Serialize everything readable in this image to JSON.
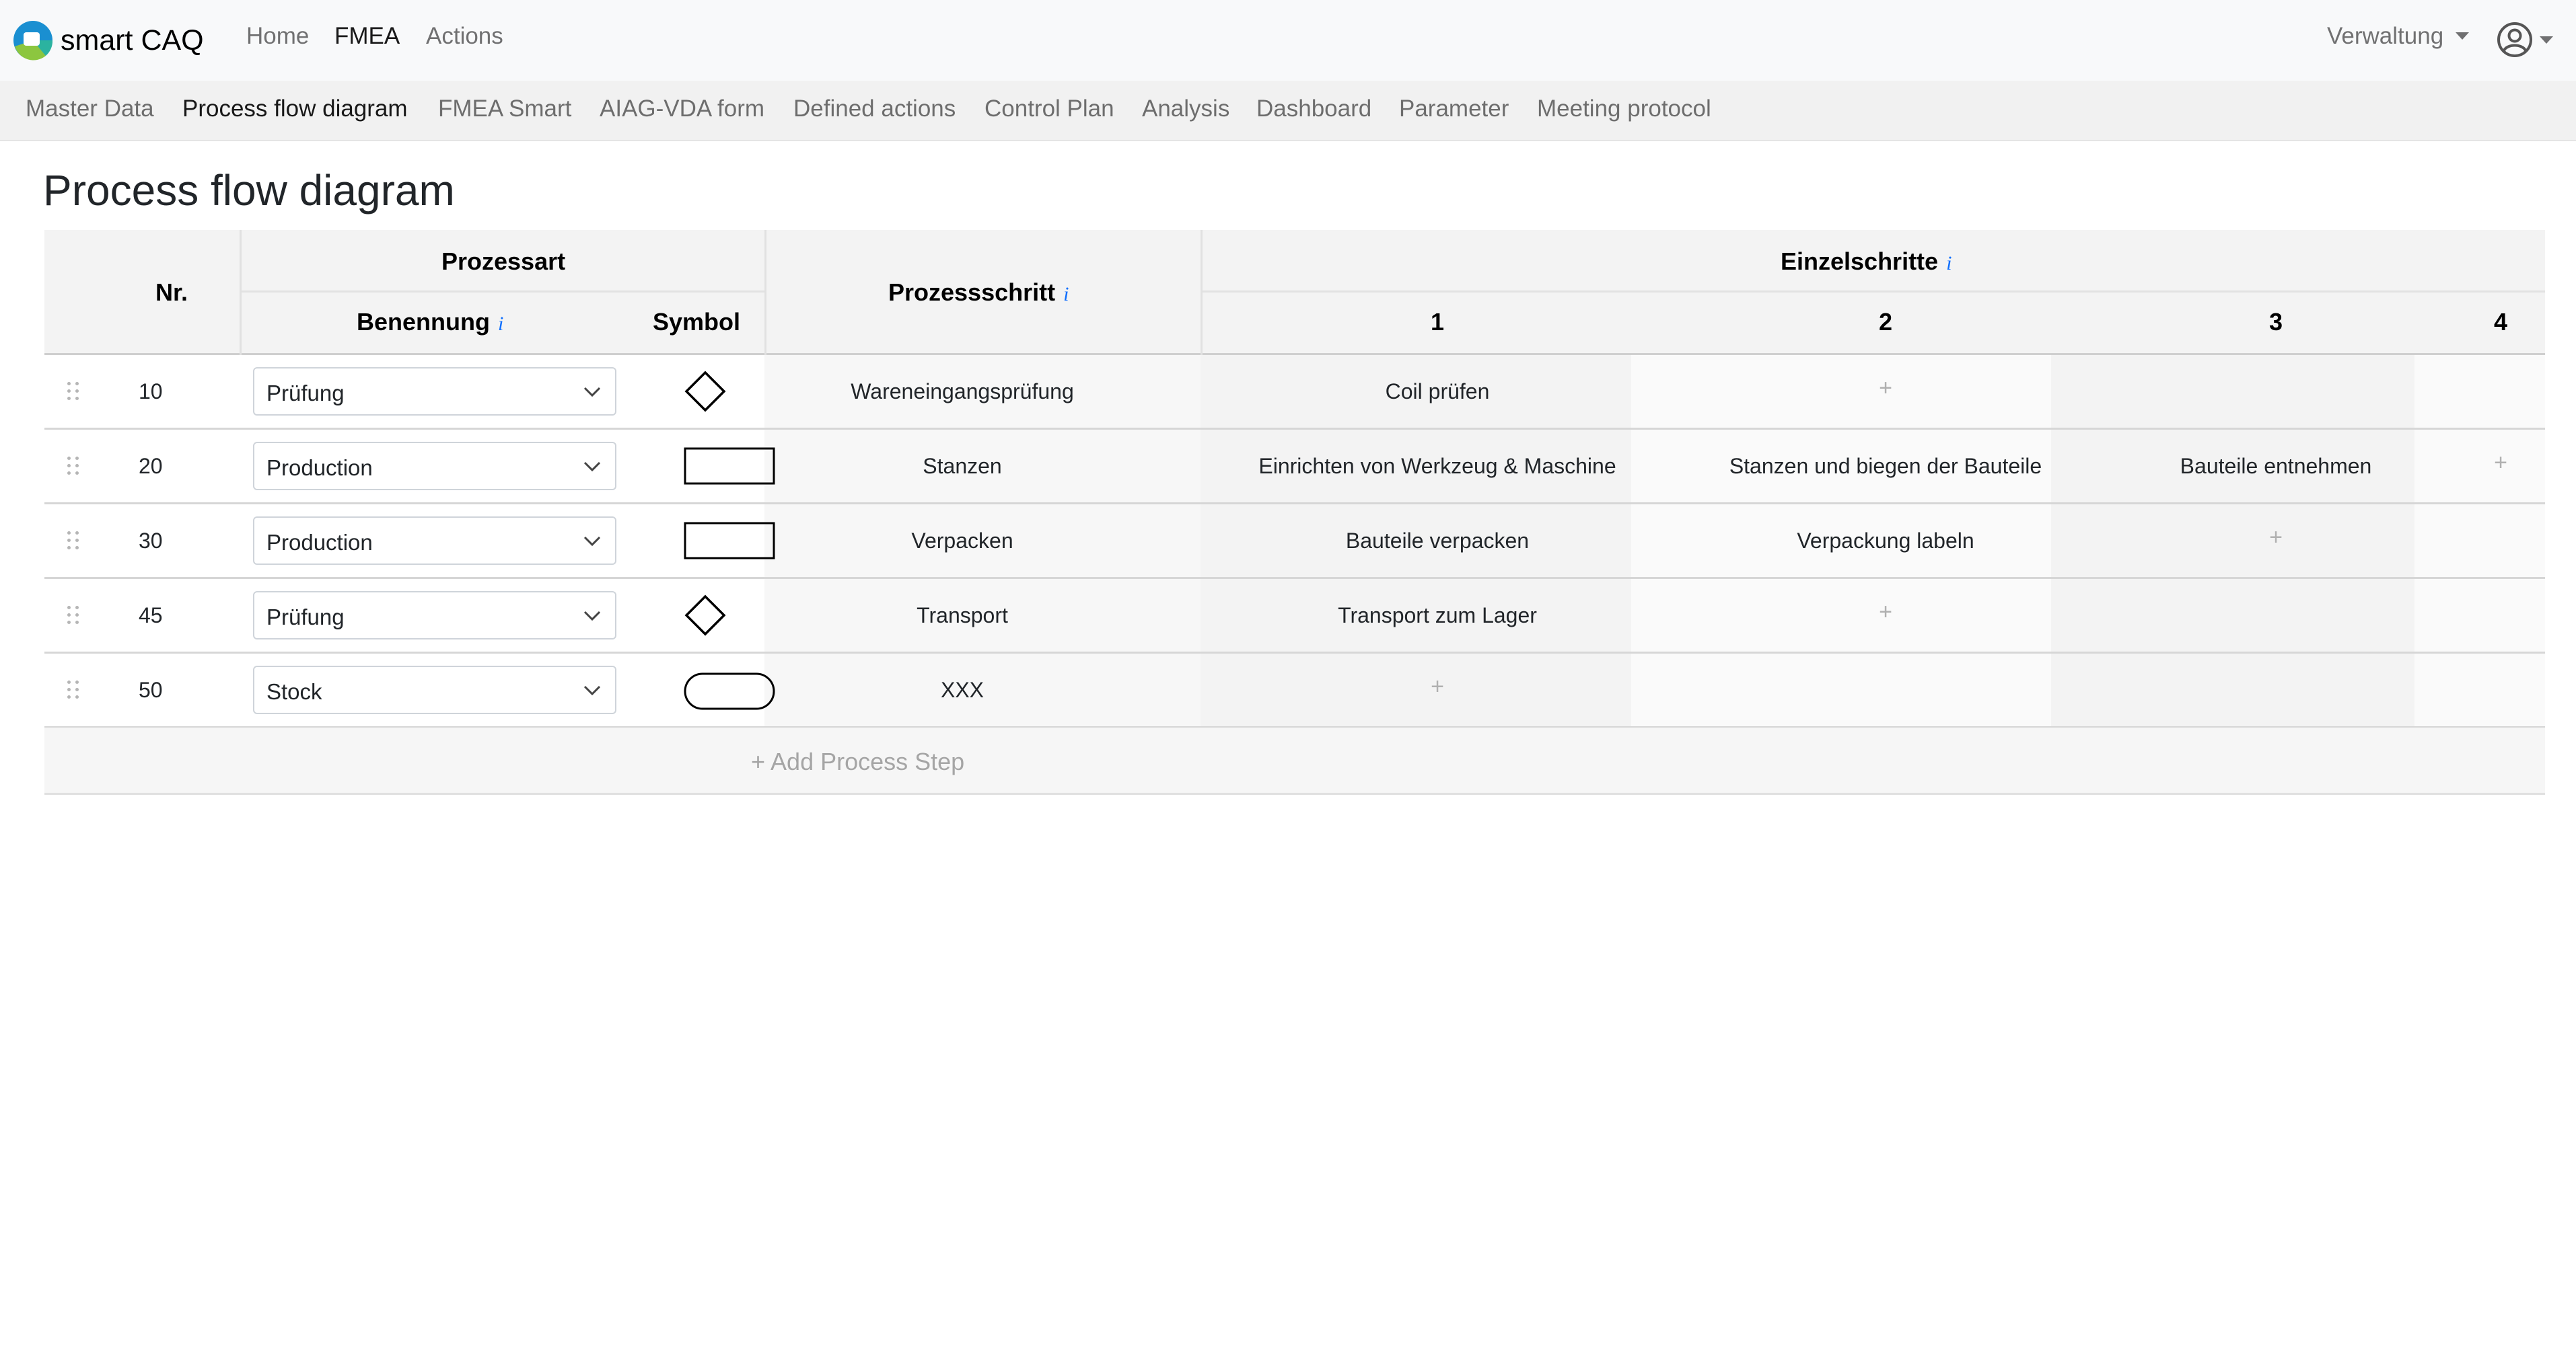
{
  "brand": {
    "name": "smart CAQ",
    "logo_colors": [
      "#1a8fd1",
      "#2bb3a0",
      "#8cc63f"
    ]
  },
  "nav": {
    "items": [
      {
        "label": "Home",
        "active": false
      },
      {
        "label": "FMEA",
        "active": true
      },
      {
        "label": "Actions",
        "active": false
      }
    ],
    "admin_label": "Verwaltung",
    "user_icon": "user-circle-icon"
  },
  "subnav": {
    "items": [
      {
        "label": "Master Data",
        "active": false
      },
      {
        "label": "Process flow diagram",
        "active": true
      },
      {
        "label": "FMEA Smart",
        "active": false
      },
      {
        "label": "AIAG-VDA form",
        "active": false
      },
      {
        "label": "Defined actions",
        "active": false
      },
      {
        "label": "Control Plan",
        "active": false
      },
      {
        "label": "Analysis",
        "active": false
      },
      {
        "label": "Dashboard",
        "active": false
      },
      {
        "label": "Parameter",
        "active": false
      },
      {
        "label": "Meeting protocol",
        "active": false
      }
    ]
  },
  "page": {
    "title": "Process flow diagram"
  },
  "table": {
    "headers": {
      "nr": "Nr.",
      "prozessart": "Prozessart",
      "benennung": "Benennung",
      "symbol": "Symbol",
      "prozessschritt": "Prozessschritt",
      "einzelschritte": "Einzelschritte",
      "info_marker": "i",
      "step_columns": [
        "1",
        "2",
        "3",
        "4"
      ]
    },
    "rows": [
      {
        "nr": "10",
        "benennung": "Prüfung",
        "symbol": "diamond",
        "prozessschritt": "Wareneingangsprüfung",
        "steps": [
          "Coil prüfen",
          "+",
          "",
          ""
        ]
      },
      {
        "nr": "20",
        "benennung": "Production",
        "symbol": "rectangle",
        "prozessschritt": "Stanzen",
        "steps": [
          "Einrichten von Werkzeug & Maschine",
          "Stanzen und biegen der Bauteile",
          "Bauteile entnehmen",
          "+"
        ]
      },
      {
        "nr": "30",
        "benennung": "Production",
        "symbol": "rectangle",
        "prozessschritt": "Verpacken",
        "steps": [
          "Bauteile verpacken",
          "Verpackung labeln",
          "+",
          ""
        ]
      },
      {
        "nr": "45",
        "benennung": "Prüfung",
        "symbol": "diamond",
        "prozessschritt": "Transport",
        "steps": [
          "Transport zum Lager",
          "+",
          "",
          ""
        ]
      },
      {
        "nr": "50",
        "benennung": "Stock",
        "symbol": "pill",
        "prozessschritt": "XXX",
        "steps": [
          "+",
          "",
          "",
          ""
        ]
      }
    ],
    "add_step_label": "+ Add Process Step"
  }
}
